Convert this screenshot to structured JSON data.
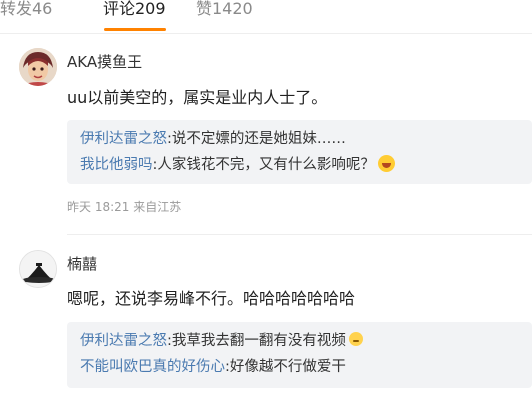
{
  "tabs": [
    {
      "label": "转发46",
      "active": false
    },
    {
      "label": "评论209",
      "active": true
    },
    {
      "label": "赞1420",
      "active": false
    }
  ],
  "accent_color": "#ff8200",
  "link_color": "#4a7ab0",
  "comments": [
    {
      "avatar": "avatar-illustrated-portrait",
      "username": "AKA摸鱼王",
      "text": "uu以前美空的，属实是业内人士了。",
      "replies": [
        {
          "user": "伊利达雷之怒",
          "text": ":说不定嫖的还是她姐妹……",
          "emoji": null
        },
        {
          "user": "我比他弱吗",
          "text": ":人家钱花不完，又有什么影响呢？",
          "emoji": "rolling-laugh-emoji-icon"
        }
      ],
      "time": "昨天 18:21 来自江苏"
    },
    {
      "avatar": "avatar-black-hat",
      "username": "楠囍",
      "text": "嗯呢，还说李易峰不行。哈哈哈哈哈哈哈",
      "replies": [
        {
          "user": "伊利达雷之怒",
          "text": ":我草我去翻一翻有没有视频",
          "emoji": "thinking-emoji-icon"
        },
        {
          "user": "不能叫欧巴真的好伤心",
          "text": ":好像越不行做爱干",
          "emoji": null
        }
      ]
    }
  ]
}
